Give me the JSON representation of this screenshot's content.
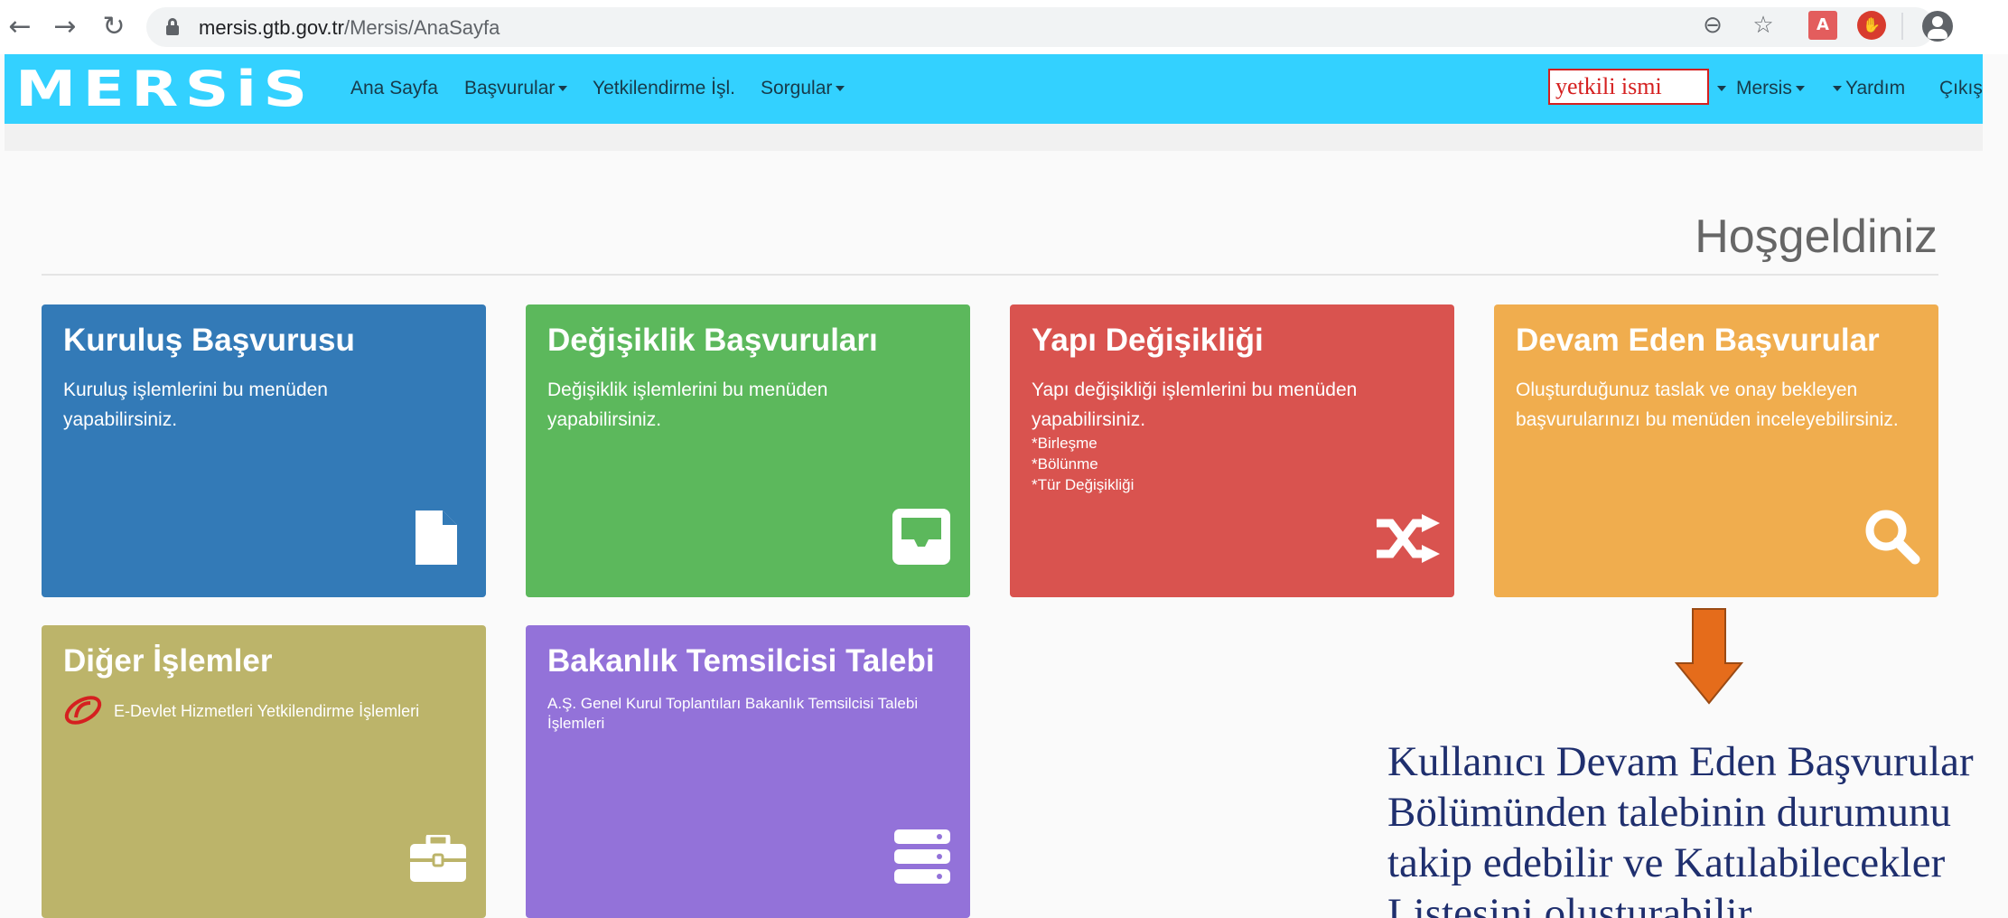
{
  "browser": {
    "url_host": "mersis.gtb.gov.tr",
    "url_path": "/Mersis/AnaSayfa"
  },
  "navbar": {
    "logo_text": "MERSiS",
    "items": [
      {
        "label": "Ana Sayfa",
        "dropdown": false
      },
      {
        "label": "Başvurular",
        "dropdown": true
      },
      {
        "label": "Yetkilendirme İşl.",
        "dropdown": false
      },
      {
        "label": "Sorgular",
        "dropdown": true
      }
    ],
    "user_box": "yetkili ismi",
    "right_items": [
      {
        "label": "Mersis",
        "dropdown": true
      },
      {
        "label": "Yardım",
        "dropdown": true
      },
      {
        "label": "Çıkış",
        "dropdown": false
      }
    ],
    "bg_color": "#33d1ff"
  },
  "page": {
    "welcome": "Hoşgeldiniz"
  },
  "tiles": [
    {
      "title": "Kuruluş Başvurusu",
      "desc": "Kuruluş işlemlerini bu menüden yapabilirsiniz.",
      "icon": "document-icon",
      "color": "#337ab7"
    },
    {
      "title": "Değişiklik Başvuruları",
      "desc": "Değişiklik işlemlerini bu menüden yapabilirsiniz.",
      "icon": "inbox-icon",
      "color": "#5cb85c"
    },
    {
      "title": "Yapı Değişikliği",
      "desc": "Yapı değişikliği işlemlerini bu menüden yapabilirsiniz.",
      "sub": [
        "*Birleşme",
        "*Bölünme",
        "*Tür Değişikliği"
      ],
      "icon": "shuffle-icon",
      "color": "#d9534f"
    },
    {
      "title": "Devam Eden Başvurular",
      "desc": "Oluşturduğunuz taslak ve onay bekleyen başvurularınızı bu menüden inceleyebilirsiniz.",
      "icon": "search-icon",
      "color": "#f0ad4e"
    },
    {
      "title": "Diğer İşlemler",
      "desc": "E-Devlet Hizmetleri Yetkilendirme İşlemleri",
      "icon": "briefcase-icon",
      "color": "#bcb46a"
    },
    {
      "title": "Bakanlık Temsilcisi Talebi",
      "desc": "A.Ş. Genel Kurul Toplantıları Bakanlık Temsilcisi Talebi İşlemleri",
      "icon": "server-icon",
      "color": "#9372d9"
    }
  ],
  "annotation": {
    "lines": [
      "Kullanıcı Devam Eden Başvurular",
      "Bölümünden talebinin durumunu",
      "takip edebilir ve Katılabilecekler",
      "Listesini oluşturabilir."
    ],
    "arrow_color": "#e56c1b"
  }
}
